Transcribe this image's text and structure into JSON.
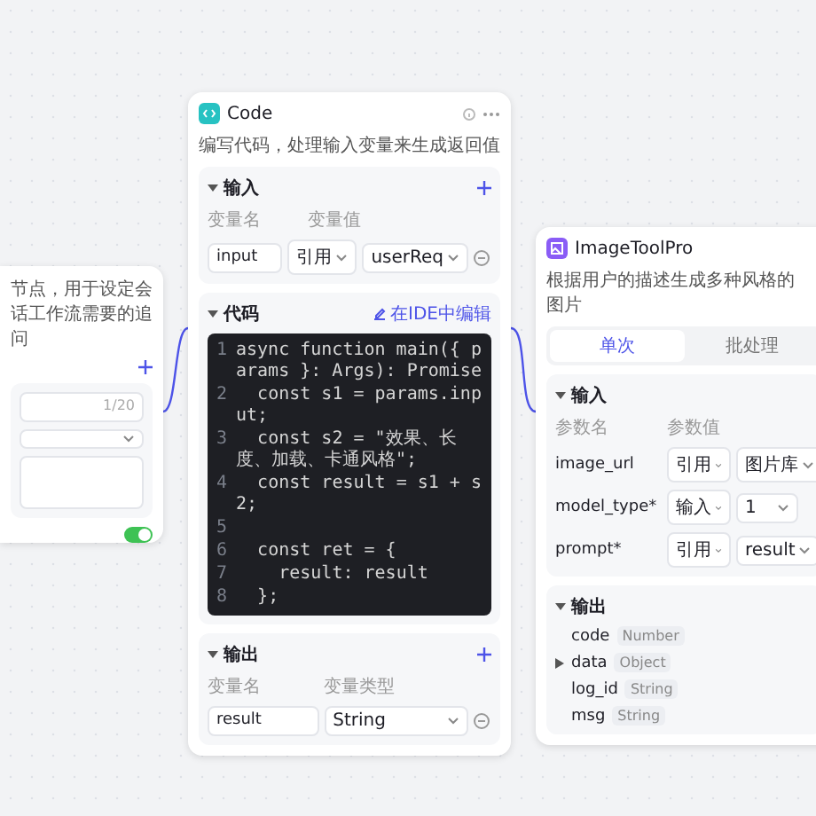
{
  "left_node": {
    "description": "节点，用于设定会话工作流需要的追问",
    "counter": "1/20",
    "toggle": {
      "on": true
    }
  },
  "code_node": {
    "title": "Code",
    "description": "编写代码，处理输入变量来生成返回值",
    "input": {
      "title": "输入",
      "columns": [
        "变量名",
        "变量值"
      ],
      "rows": [
        {
          "name": "input",
          "source": "引用",
          "value": "userReq"
        }
      ]
    },
    "code": {
      "title": "代码",
      "edit_link": "在IDE中编辑",
      "lines": [
        {
          "number": "1",
          "text": "async function main({ params }: Args): Promise"
        },
        {
          "number": "2",
          "text": "  const s1 = params.input;"
        },
        {
          "number": "3",
          "text": "  const s2 = \"效果、长度、加载、卡通风格\";"
        },
        {
          "number": "4",
          "text": "  const result = s1 + s2;"
        },
        {
          "number": "5"
        },
        {
          "number": "6",
          "text": "  const ret = {"
        },
        {
          "number": "7",
          "text": "    result: result"
        },
        {
          "number": "8",
          "text": "  };"
        }
      ]
    },
    "output": {
      "title": "输出",
      "columns": [
        "变量名",
        "变量类型"
      ],
      "rows": [
        {
          "name": "result",
          "type": "String"
        }
      ]
    }
  },
  "plugin_node": {
    "title": "ImageToolPro",
    "description": "根据用户的描述生成多种风格的图片",
    "tabs": [
      {
        "label": "单次",
        "selected": true
      },
      {
        "label": "批处理",
        "selected": false
      }
    ],
    "input": {
      "title": "输入",
      "columns": [
        "参数名",
        "参数值"
      ],
      "rows": [
        {
          "name": "image_url",
          "source": "引用",
          "value": "图片库"
        },
        {
          "name": "model_type*",
          "source": "输入",
          "value": "1"
        },
        {
          "name": "prompt*",
          "source": "引用",
          "value": "result"
        }
      ]
    },
    "output": {
      "title": "输出",
      "items": [
        {
          "name": "code",
          "type": "Number",
          "kind": "field"
        },
        {
          "name": "data",
          "type": "Object",
          "kind": "object"
        },
        {
          "name": "log_id",
          "type": "String",
          "kind": "field"
        },
        {
          "name": "msg",
          "type": "String",
          "kind": "field"
        }
      ]
    }
  }
}
